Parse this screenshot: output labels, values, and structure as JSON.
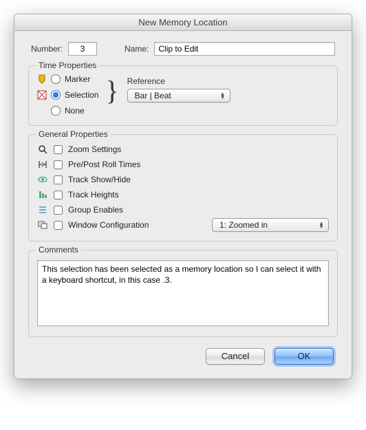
{
  "window": {
    "title": "New Memory Location"
  },
  "header": {
    "number_label": "Number:",
    "number_value": "3",
    "name_label": "Name:",
    "name_value": "Clip to Edit"
  },
  "time_properties": {
    "title": "Time Properties",
    "options": {
      "marker": "Marker",
      "selection": "Selection",
      "none": "None"
    },
    "selected": "selection",
    "reference_label": "Reference",
    "reference_value": "Bar | Beat"
  },
  "general_properties": {
    "title": "General Properties",
    "items": {
      "zoom": "Zoom Settings",
      "preroll": "Pre/Post Roll Times",
      "trackshow": "Track Show/Hide",
      "trackheights": "Track Heights",
      "groupenables": "Group Enables",
      "windowconfig": "Window Configuration"
    },
    "window_config_value": "1: Zoomed in"
  },
  "comments": {
    "title": "Comments",
    "text": "This selection has been selected as a memory location so I can select it with a keyboard shortcut, in this case .3."
  },
  "buttons": {
    "cancel": "Cancel",
    "ok": "OK"
  }
}
